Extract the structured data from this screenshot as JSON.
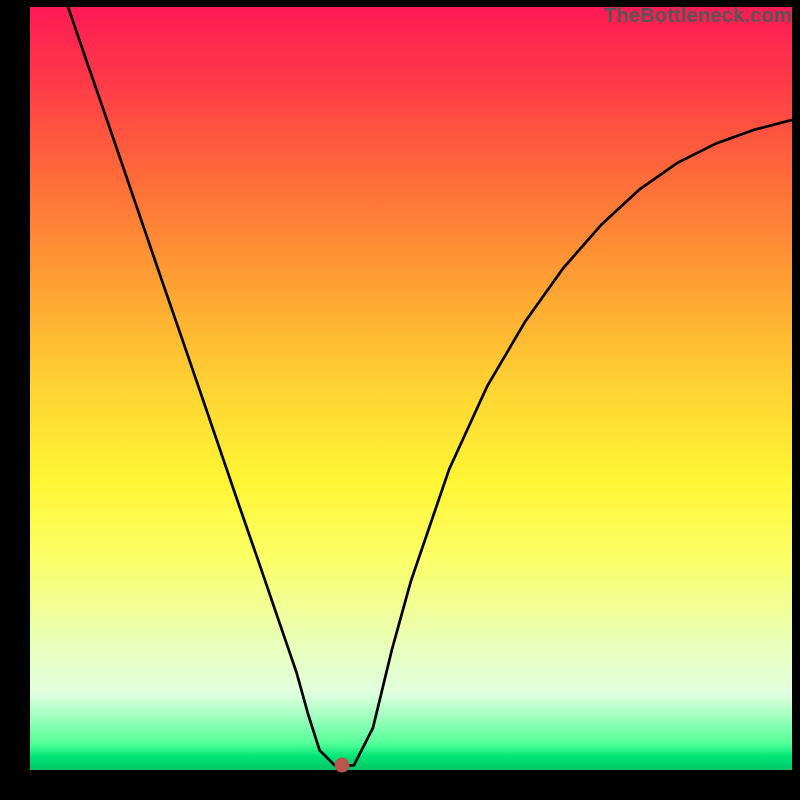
{
  "credit_text": "TheBottleneck.com",
  "chart_data": {
    "type": "line",
    "title": "",
    "xlabel": "",
    "ylabel": "",
    "xlim": [
      0,
      100
    ],
    "ylim": [
      0,
      100
    ],
    "series": [
      {
        "name": "bottleneck-curve",
        "x": [
          5.0,
          7.5,
          10.0,
          12.5,
          15.0,
          17.5,
          20.0,
          22.5,
          25.0,
          27.5,
          30.0,
          32.5,
          35.0,
          36.5,
          38.0,
          40.0,
          42.5,
          45.0,
          47.5,
          50.0,
          55.0,
          60.0,
          65.0,
          70.0,
          75.0,
          80.0,
          85.0,
          90.0,
          95.0,
          100.0
        ],
        "y": [
          100.0,
          92.7,
          85.5,
          78.2,
          70.9,
          63.6,
          56.4,
          49.1,
          41.8,
          34.5,
          27.3,
          20.0,
          12.7,
          7.3,
          2.6,
          0.6,
          0.6,
          5.5,
          15.8,
          24.8,
          39.4,
          50.3,
          58.8,
          65.8,
          71.5,
          76.1,
          79.6,
          82.1,
          83.9,
          85.2
        ]
      }
    ],
    "marker": {
      "x": 41.0,
      "y": 0.6
    }
  }
}
